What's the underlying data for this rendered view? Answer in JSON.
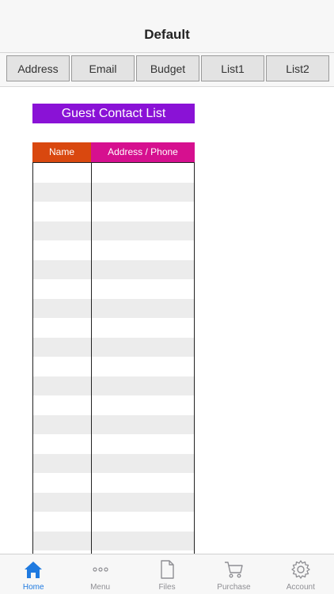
{
  "header": {
    "title": "Default"
  },
  "tabs": [
    {
      "label": "Address"
    },
    {
      "label": "Email"
    },
    {
      "label": "Budget"
    },
    {
      "label": "List1"
    },
    {
      "label": "List2"
    }
  ],
  "list": {
    "title": "Guest Contact List",
    "title_color": "#8a12d6",
    "columns": [
      {
        "label": "Name",
        "color": "#d9480f"
      },
      {
        "label": "Address / Phone",
        "color": "#d6108f"
      }
    ]
  },
  "bottom_nav": [
    {
      "label": "Home",
      "icon": "home-icon",
      "active": true
    },
    {
      "label": "Menu",
      "icon": "more-icon",
      "active": false
    },
    {
      "label": "Files",
      "icon": "file-icon",
      "active": false
    },
    {
      "label": "Purchase",
      "icon": "cart-icon",
      "active": false
    },
    {
      "label": "Account",
      "icon": "gear-icon",
      "active": false
    }
  ],
  "colors": {
    "accent": "#1f7ae0",
    "inactive": "#8e8e93"
  }
}
